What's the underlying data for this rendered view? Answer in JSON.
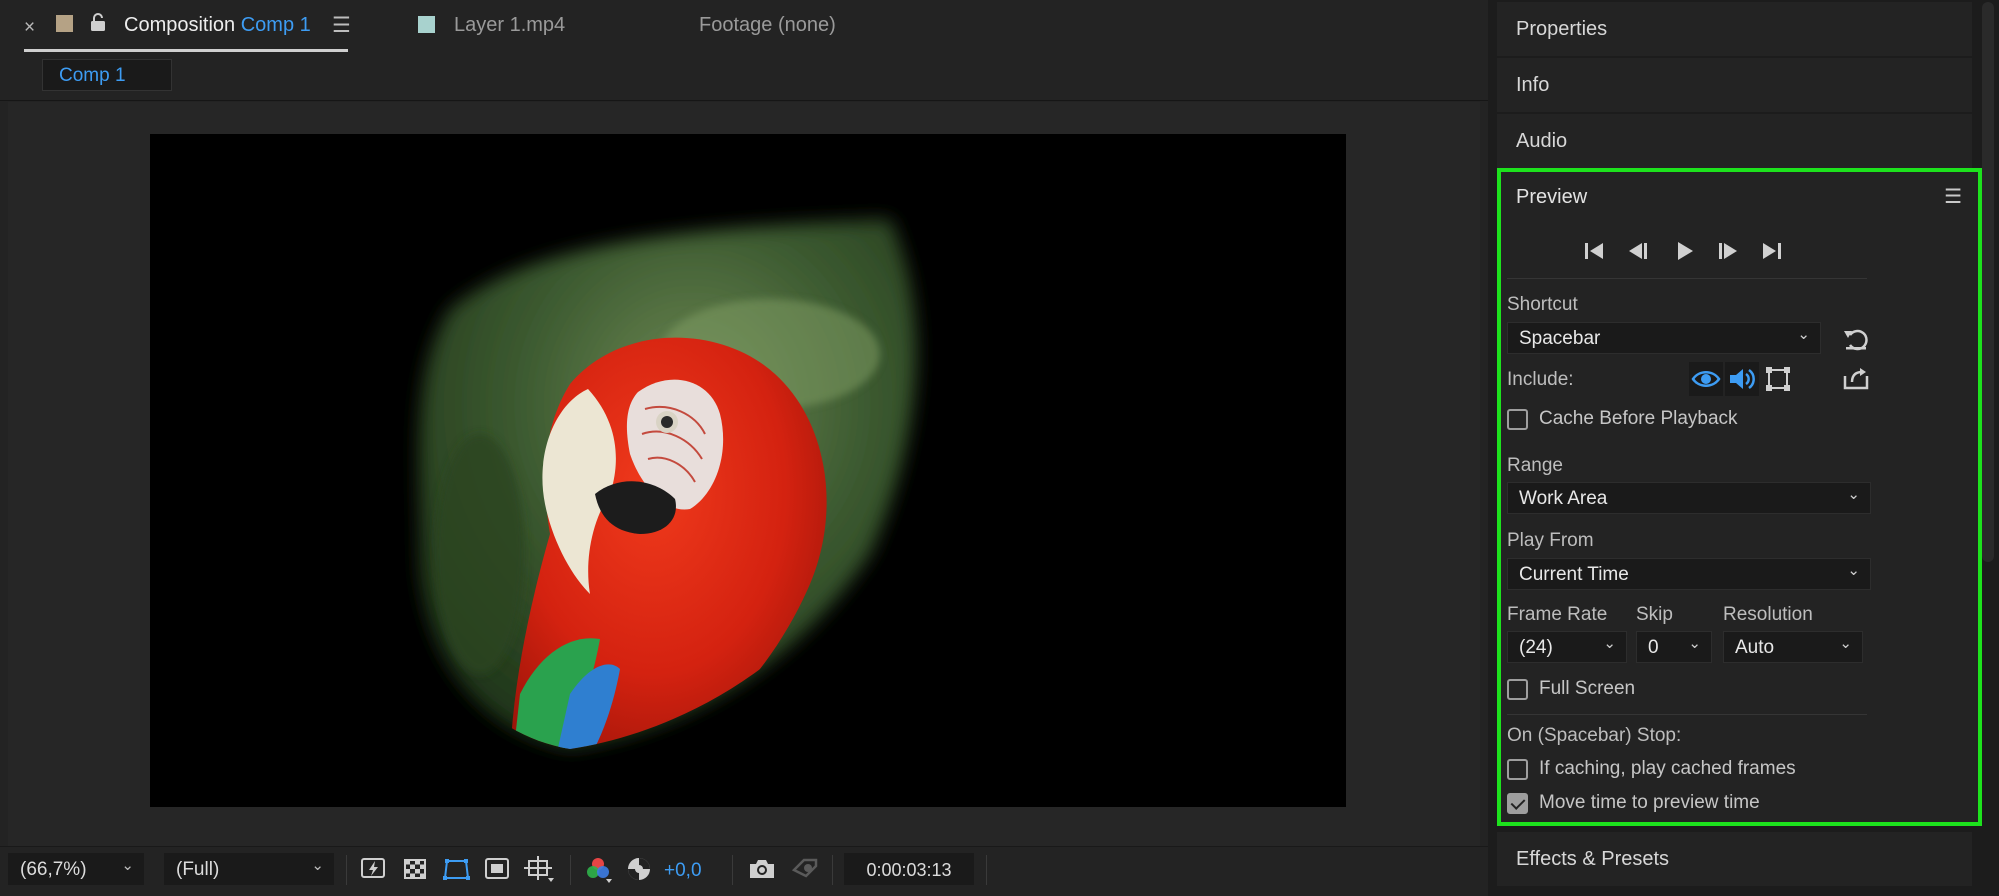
{
  "composition_tab": {
    "title_prefix": "Composition",
    "comp_name": "Comp 1",
    "close_glyph": "×",
    "menu_glyph": "☰"
  },
  "layer_tab": {
    "label": "Layer 1.mp4"
  },
  "footage_tab": {
    "label": "Footage (none)"
  },
  "comp_chip": "Comp 1",
  "viewer_toolbar": {
    "magnification": "(66,7%)",
    "resolution": "(Full)",
    "exposure": "+0,0",
    "current_time": "0:00:03:13"
  },
  "panels": {
    "properties": "Properties",
    "info": "Info",
    "audio": "Audio",
    "effects": "Effects & Presets"
  },
  "preview": {
    "title": "Preview",
    "shortcut_label": "Shortcut",
    "shortcut_value": "Spacebar",
    "include_label": "Include:",
    "cache_before_playback": "Cache Before Playback",
    "range_label": "Range",
    "range_value": "Work Area",
    "play_from_label": "Play From",
    "play_from_value": "Current Time",
    "frame_rate_label": "Frame Rate",
    "frame_rate_value": "(24)",
    "skip_label": "Skip",
    "skip_value": "0",
    "resolution_label": "Resolution",
    "resolution_value": "Auto",
    "full_screen": "Full Screen",
    "on_stop_label": "On (Spacebar) Stop:",
    "if_caching": "If caching, play cached frames",
    "move_time": "Move time to preview time",
    "checkbox_states": {
      "cache_before_playback": false,
      "full_screen": false,
      "if_caching": false,
      "move_time": true
    },
    "include_toggles": {
      "video": true,
      "audio": true,
      "overlays": false
    }
  },
  "colors": {
    "accent_blue": "#3d9cf3",
    "highlight_green": "#1de21d",
    "panel_bg": "#232323"
  }
}
